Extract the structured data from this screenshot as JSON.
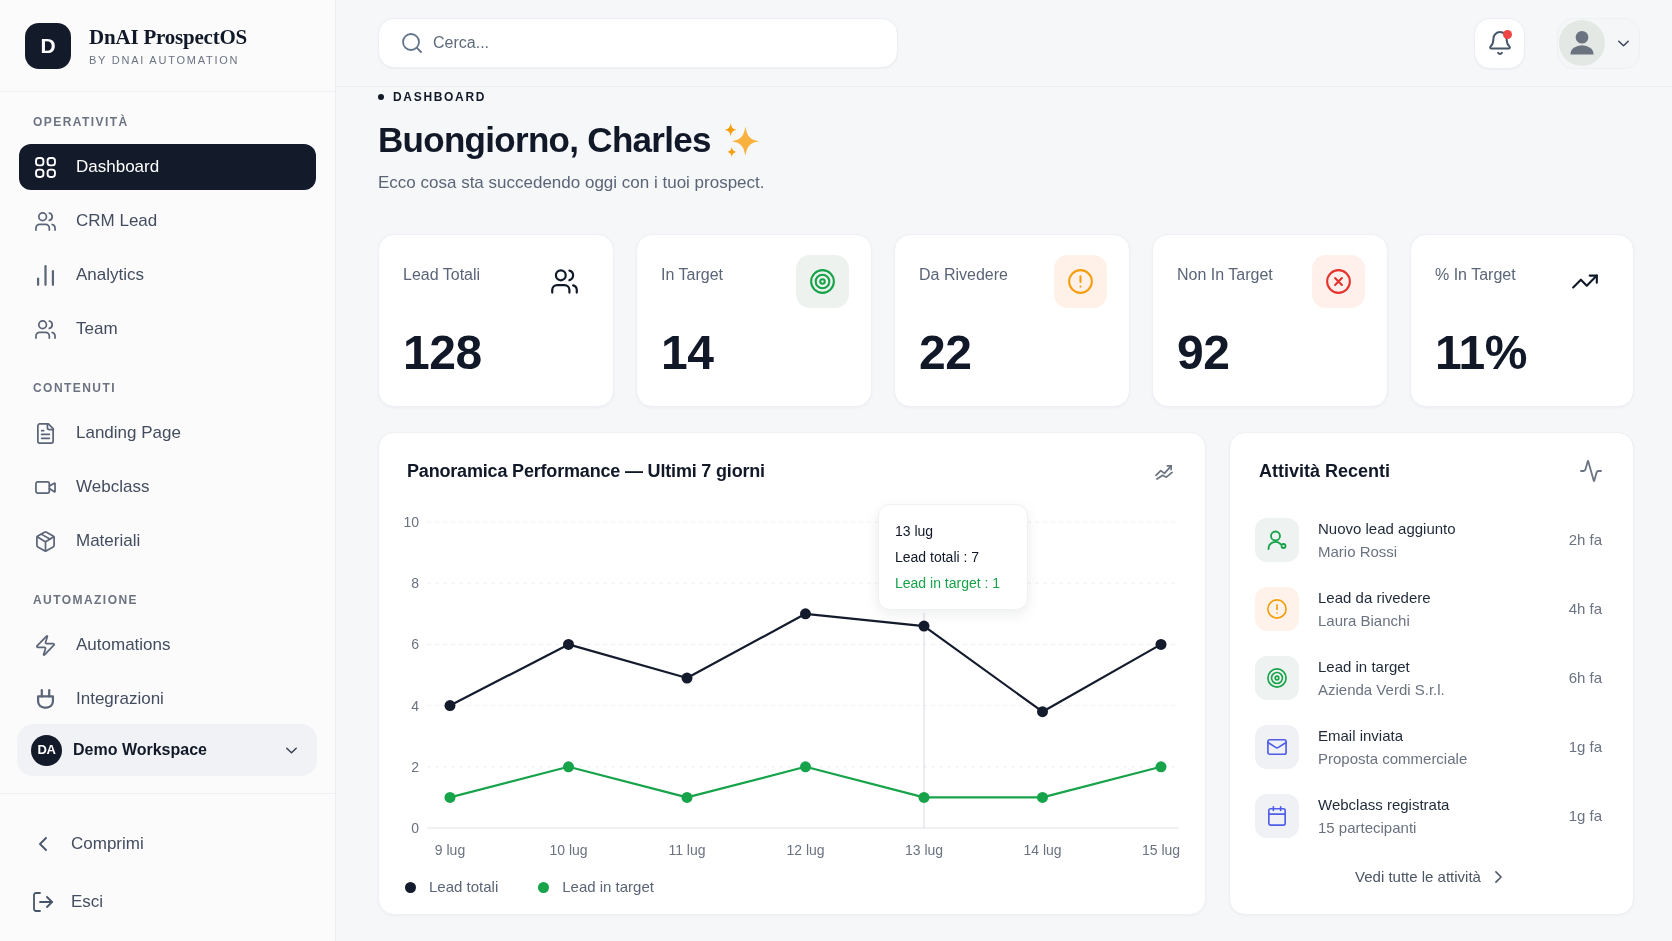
{
  "brand": {
    "mark": "D",
    "name": "DnAI ProspectOS",
    "tagline": "BY DNAI AUTOMATION"
  },
  "sidebar": {
    "sections": [
      {
        "title": "OPERATIVITÀ",
        "items": [
          {
            "label": "Dashboard",
            "kind": "dashboard",
            "selected": true
          },
          {
            "label": "CRM Lead",
            "kind": "leads",
            "selected": false
          },
          {
            "label": "Analytics",
            "kind": "analytics",
            "selected": false
          },
          {
            "label": "Team",
            "kind": "team",
            "selected": false
          }
        ]
      },
      {
        "title": "CONTENUTI",
        "items": [
          {
            "label": "Landing Page",
            "kind": "pages",
            "selected": false
          },
          {
            "label": "Webclass",
            "kind": "webclass",
            "selected": false
          },
          {
            "label": "Materiali",
            "kind": "materials",
            "selected": false
          }
        ]
      },
      {
        "title": "AUTOMAZIONE",
        "items": [
          {
            "label": "Automations",
            "kind": "automations",
            "selected": false
          },
          {
            "label": "Integrazioni",
            "kind": "integrations",
            "selected": false
          }
        ]
      }
    ],
    "workspace": {
      "initials": "DA",
      "name": "Demo Workspace"
    },
    "footer_items": [
      {
        "label": "Comprimi",
        "kind": "collapse"
      },
      {
        "label": "Esci",
        "kind": "logout"
      }
    ]
  },
  "header": {
    "search": {
      "placeholder": "Cerca..."
    },
    "notifications": {
      "unread": true
    }
  },
  "page": {
    "breadcrumb": "DASHBOARD",
    "title": "Buongiorno, Charles",
    "subtitle": "Ecco cosa sta succedendo oggi con i tuoi prospect."
  },
  "stats": [
    {
      "kind": "total",
      "label": "Lead Totali",
      "value": "128"
    },
    {
      "kind": "target",
      "label": "In Target",
      "value": "14"
    },
    {
      "kind": "review",
      "label": "Da Rivedere",
      "value": "22"
    },
    {
      "kind": "rejected",
      "label": "Non In Target",
      "value": "92"
    },
    {
      "kind": "rate",
      "label": "% In Target",
      "value": "11%"
    }
  ],
  "performance": {
    "chart_data": {
      "type": "line",
      "title": "Panoramica Performance — Ultimi 7 giorni",
      "categories": [
        "9 lug",
        "10 lug",
        "11 lug",
        "12 lug",
        "13 lug",
        "14 lug",
        "15 lug"
      ],
      "series": [
        {
          "name": "Lead totali",
          "color": "#141b2d",
          "marker": "circle",
          "values": [
            4,
            6,
            4.9,
            7,
            6.6,
            3.8,
            6
          ]
        },
        {
          "name": "Lead in target",
          "color": "#16a34a",
          "marker": "circle",
          "values": [
            1,
            2,
            1,
            2,
            1,
            1,
            2
          ]
        }
      ],
      "ylim": [
        0,
        10
      ],
      "yticks": [
        0,
        2,
        4,
        6,
        8,
        10
      ],
      "grid": true,
      "ref_lines": [
        {
          "axis": "x",
          "value": "13 lug",
          "color": "#d6dae0"
        }
      ]
    },
    "tooltip": {
      "title": "13 lug",
      "lines": [
        {
          "kind": "total",
          "text": "Lead totali : 7"
        },
        {
          "kind": "target",
          "text": "Lead in target : 1"
        }
      ]
    }
  },
  "activity": {
    "title": "Attività Recenti",
    "items": [
      {
        "kind": "lead",
        "title": "Nuovo lead aggiunto",
        "detail": "Mario Rossi",
        "time": "2h fa"
      },
      {
        "kind": "review",
        "title": "Lead da rivedere",
        "detail": "Laura Bianchi",
        "time": "4h fa"
      },
      {
        "kind": "target",
        "title": "Lead in target",
        "detail": "Azienda Verdi S.r.l.",
        "time": "6h fa"
      },
      {
        "kind": "email",
        "title": "Email inviata",
        "detail": "Proposta commerciale",
        "time": "1g fa"
      },
      {
        "kind": "webclass",
        "title": "Webclass registrata",
        "detail": "15 partecipanti",
        "time": "1g fa"
      }
    ],
    "link": "Vedi tutte le attività"
  }
}
